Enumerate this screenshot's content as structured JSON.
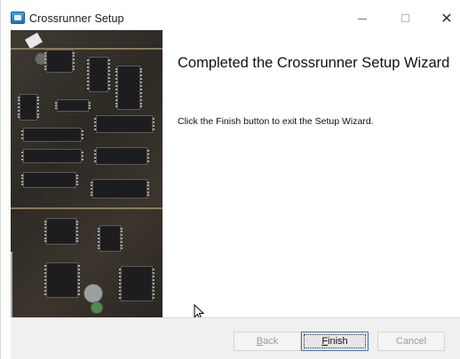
{
  "window": {
    "title": "Crossrunner Setup",
    "app_icon": "installer-app-icon"
  },
  "titlebar_controls": {
    "minimize_icon": "minimize-icon",
    "maximize_icon": "maximize-icon",
    "close_icon": "close-icon",
    "close_glyph": "✕"
  },
  "content": {
    "heading": "Completed the Crossrunner Setup Wizard",
    "description": "Click the Finish button to exit the Setup Wizard."
  },
  "buttons": {
    "back": {
      "mnemonic": "B",
      "rest": "ack",
      "enabled": false
    },
    "finish": {
      "mnemonic": "F",
      "rest": "inish",
      "enabled": true,
      "focused": true
    },
    "cancel": {
      "label": "Cancel",
      "enabled": false
    }
  },
  "colors": {
    "focus_border": "#3b78c8",
    "bottom_bar": "#f0f0f0"
  }
}
